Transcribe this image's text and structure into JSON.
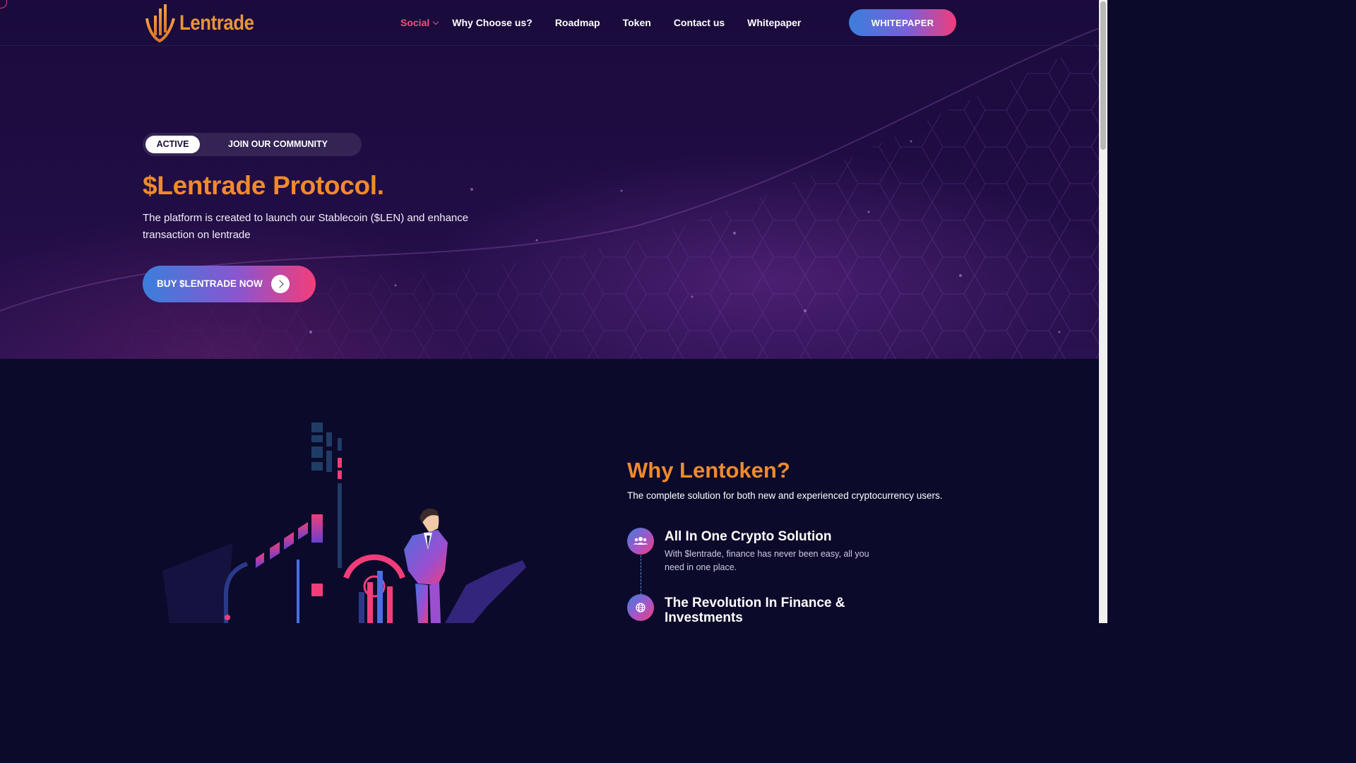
{
  "brand": {
    "name": "Lentrade"
  },
  "nav": {
    "items": [
      {
        "label": "Social",
        "active": true,
        "has_dropdown": true
      },
      {
        "label": "Why Choose us?"
      },
      {
        "label": "Roadmap"
      },
      {
        "label": "Token"
      },
      {
        "label": "Contact us"
      },
      {
        "label": "Whitepaper"
      }
    ],
    "cta_label": "WHITEPAPER"
  },
  "hero": {
    "pill_active": "ACTIVE",
    "pill_join": "JOIN OUR COMMUNITY",
    "title": "$Lentrade Protocol.",
    "description": "The platform is created to launch our Stablecoin ($LEN) and enhance transaction on lentrade",
    "buy_label": "BUY $LENTRADE NOW"
  },
  "why": {
    "title": "Why Lentoken?",
    "subtitle": "The complete solution for both new and experienced cryptocurrency users.",
    "features": [
      {
        "icon": "users-icon",
        "title": "All In One Crypto Solution",
        "description": "With $lentrade, finance has never been easy, all you need in one place."
      },
      {
        "icon": "globe-icon",
        "title": "The Revolution In Finance & Investments",
        "description": ""
      }
    ]
  },
  "colors": {
    "accent_orange": "#f08a2c",
    "accent_pink": "#f23d7a",
    "accent_blue": "#3a7fdc",
    "hero_bg": "#1f0d42",
    "section_bg": "#0b0a2a"
  }
}
